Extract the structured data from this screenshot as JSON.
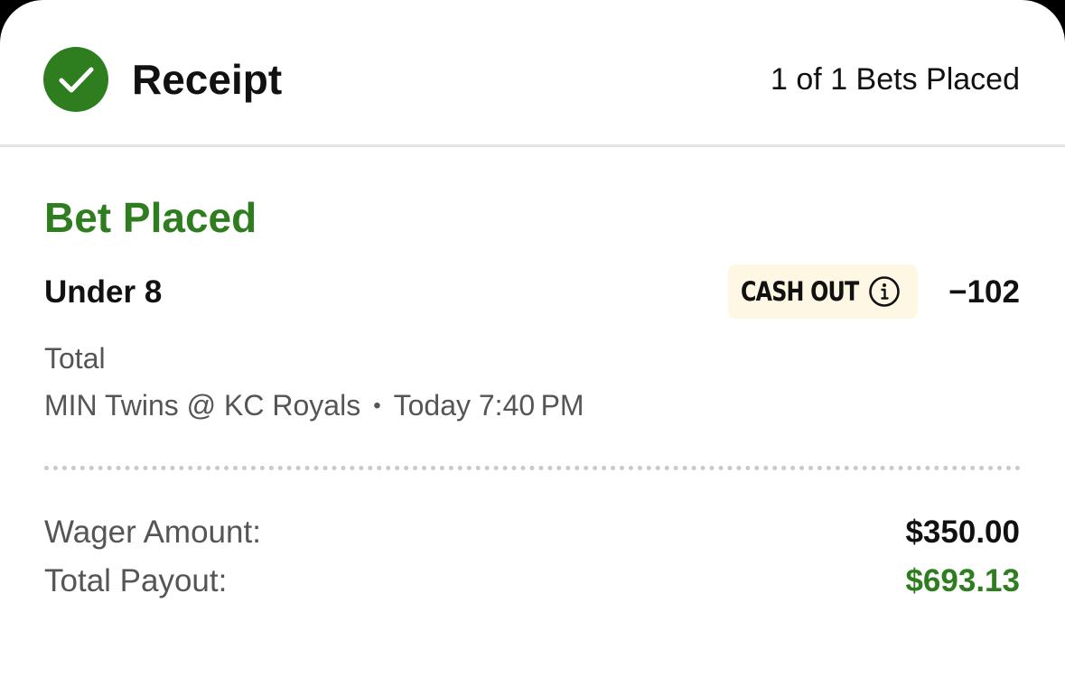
{
  "header": {
    "title": "Receipt",
    "bets_count": "1 of 1 Bets Placed",
    "status_icon": "checkmark-circle-icon"
  },
  "bet": {
    "status": "Bet Placed",
    "selection": "Under 8",
    "cash_out_label": "CASH OUT",
    "cash_out_icon": "info-icon",
    "odds": "−102",
    "market": "Total",
    "event": "MIN Twins @ KC Royals",
    "separator": "•",
    "time": "Today 7:40 PM"
  },
  "summary": {
    "wager_label": "Wager Amount:",
    "wager_value": "$350.00",
    "payout_label": "Total Payout:",
    "payout_value": "$693.13"
  },
  "colors": {
    "accent_green": "#2e7d1f",
    "cash_out_background": "#fdf7e3",
    "text_primary": "#111111",
    "text_secondary": "#555555"
  }
}
